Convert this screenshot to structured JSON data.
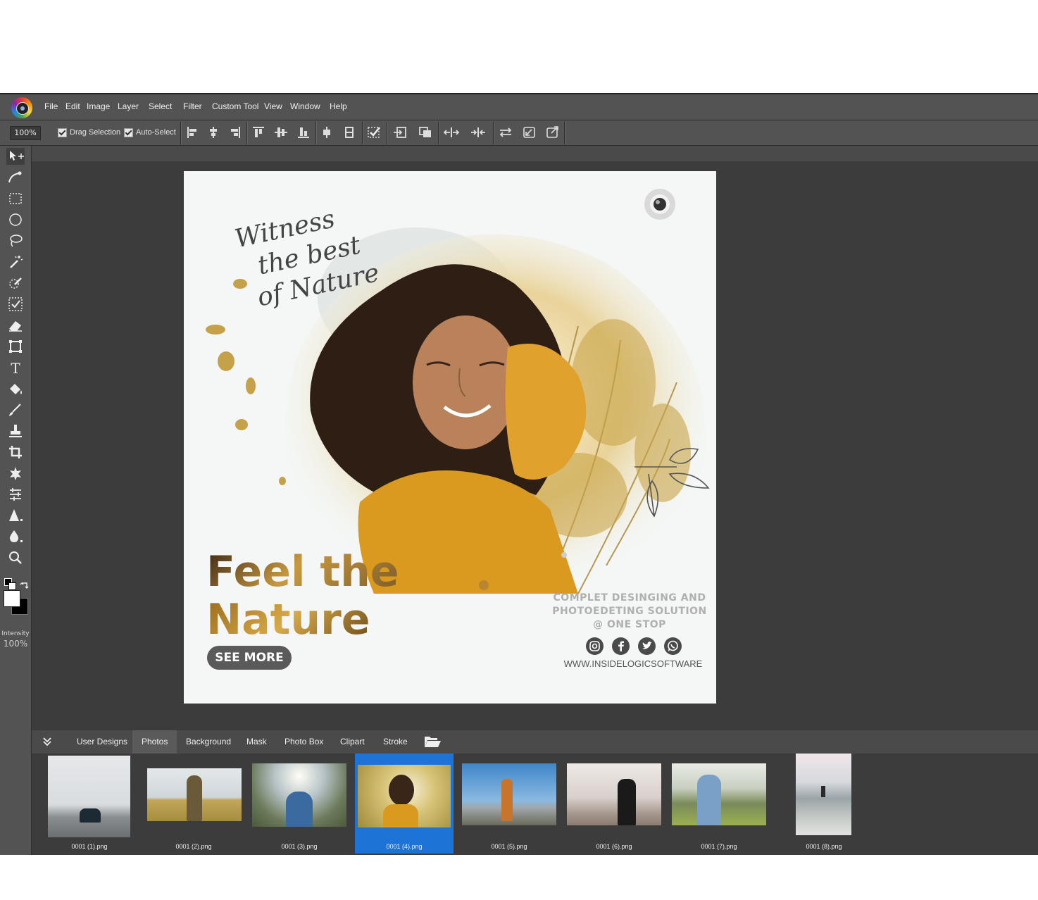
{
  "menu": {
    "items": [
      "File",
      "Edit",
      "Image",
      "Layer",
      "Select",
      "Filter",
      "Custom Tool",
      "View",
      "Window",
      "Help"
    ]
  },
  "options": {
    "zoom": "100%",
    "drag_selection_label": "Drag Selection",
    "auto_select_label": "Auto-Select"
  },
  "tools": {
    "intensity_label": "Intensity",
    "intensity_value": "100%"
  },
  "canvas": {
    "script_text_lines": [
      "Witness",
      "the best",
      "of Nature"
    ],
    "headline_line1": "Feel the",
    "headline_line2": "Nature",
    "cta_label": "SEE MORE",
    "tagline_lines": [
      "COMPLET DESINGING AND",
      "PHOTOEDETING SOLUTION",
      "@ ONE STOP"
    ],
    "website": "WWW.INSIDELOGICSOFTWARE",
    "social_icons": [
      "instagram-icon",
      "facebook-icon",
      "twitter-icon",
      "whatsapp-icon"
    ]
  },
  "panel": {
    "tabs": [
      "User Designs",
      "Photos",
      "Background",
      "Mask",
      "Photo Box",
      "Clipart",
      "Stroke"
    ],
    "active_tab": "Photos",
    "thumbnails": [
      {
        "caption": "0001 (1).png"
      },
      {
        "caption": "0001 (2).png"
      },
      {
        "caption": "0001 (3).png"
      },
      {
        "caption": "0001 (4).png"
      },
      {
        "caption": "0001 (5).png"
      },
      {
        "caption": "0001 (6).png"
      },
      {
        "caption": "0001 (7).png"
      },
      {
        "caption": "0001 (8).png"
      }
    ],
    "selected_thumbnail": "0001 (4).png"
  },
  "colors": {
    "accent": "#1e73d6",
    "panel": "#535353",
    "workspace": "#3c3c3c",
    "headline_gold": "#b8862e",
    "sweater": "#d99a1f"
  }
}
